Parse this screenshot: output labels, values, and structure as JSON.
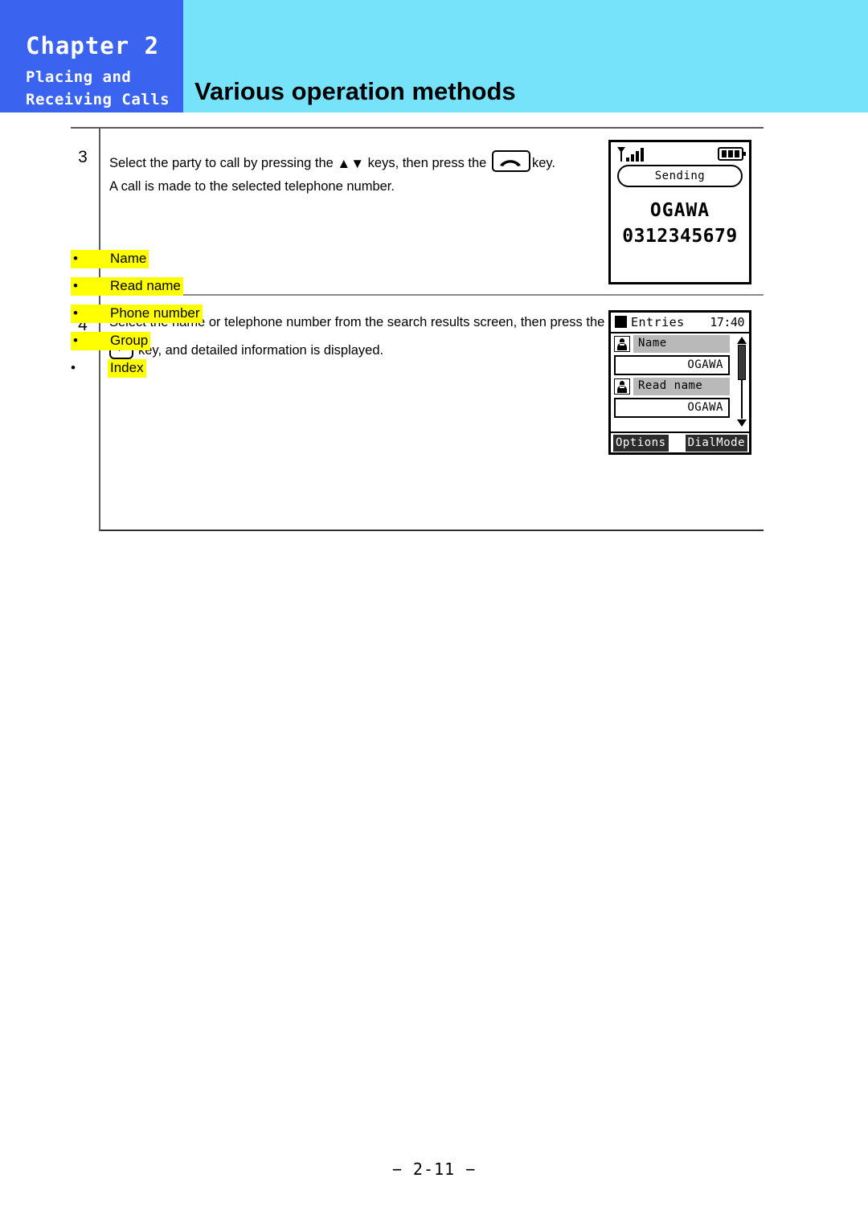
{
  "header": {
    "chapter": "Chapter 2",
    "chapter_sub_line1": "Placing and",
    "chapter_sub_line2": "Receiving Calls",
    "title": "Various operation methods",
    "blue": "#3a63f0",
    "cyan": "#76e3fb"
  },
  "steps": [
    {
      "number": "3",
      "line1_a": "Select the party to call by pressing the",
      "line1_up": "▲",
      "line1_down": "▼",
      "line1_b": "keys, then press the",
      "line1_c": "key.",
      "line2": "A call is made to the selected telephone number."
    },
    {
      "number": "4",
      "line1": "Select the name or telephone number from the search results screen, then press the",
      "enter_glyph": "↵",
      "line2": "key, and detailed information is displayed."
    }
  ],
  "bullets": [
    {
      "dot": "•",
      "label": "Name",
      "highlight": "#ffff00",
      "highlight_includes_bullet": true
    },
    {
      "dot": "•",
      "label": "Read name",
      "highlight": "#ffff00",
      "highlight_includes_bullet": true
    },
    {
      "dot": "•",
      "label": "Phone number",
      "highlight": "#ffff00",
      "highlight_includes_bullet": true
    },
    {
      "dot": "•",
      "label": "Group",
      "highlight": "#ffff00",
      "highlight_includes_bullet": true
    },
    {
      "dot": "•",
      "label": "Index",
      "highlight": "#ffff00",
      "highlight_includes_bullet": false
    }
  ],
  "phone_screen_1": {
    "signal_icon": "signal-bars-icon",
    "signal_bars": 4,
    "battery_icon": "battery-icon",
    "battery_segments": 3,
    "status_pill": "Sending",
    "name": "OGAWA",
    "number": "0312345679"
  },
  "phone_screen_2": {
    "title_square_icon": "filled-square-icon",
    "title": "Entries",
    "time": "17:40",
    "fields": [
      {
        "icon": "contact-person-icon",
        "label": "Name",
        "value": "OGAWA"
      },
      {
        "icon": "contact-person-icon",
        "label": "Read name",
        "value": "OGAWA"
      }
    ],
    "scrollbar": {
      "up_arrow": "▲",
      "down_arrow": "▼"
    },
    "softkey_left": "Options",
    "softkey_right": "DialMode"
  },
  "footer": {
    "page": "− 2-11 −"
  }
}
